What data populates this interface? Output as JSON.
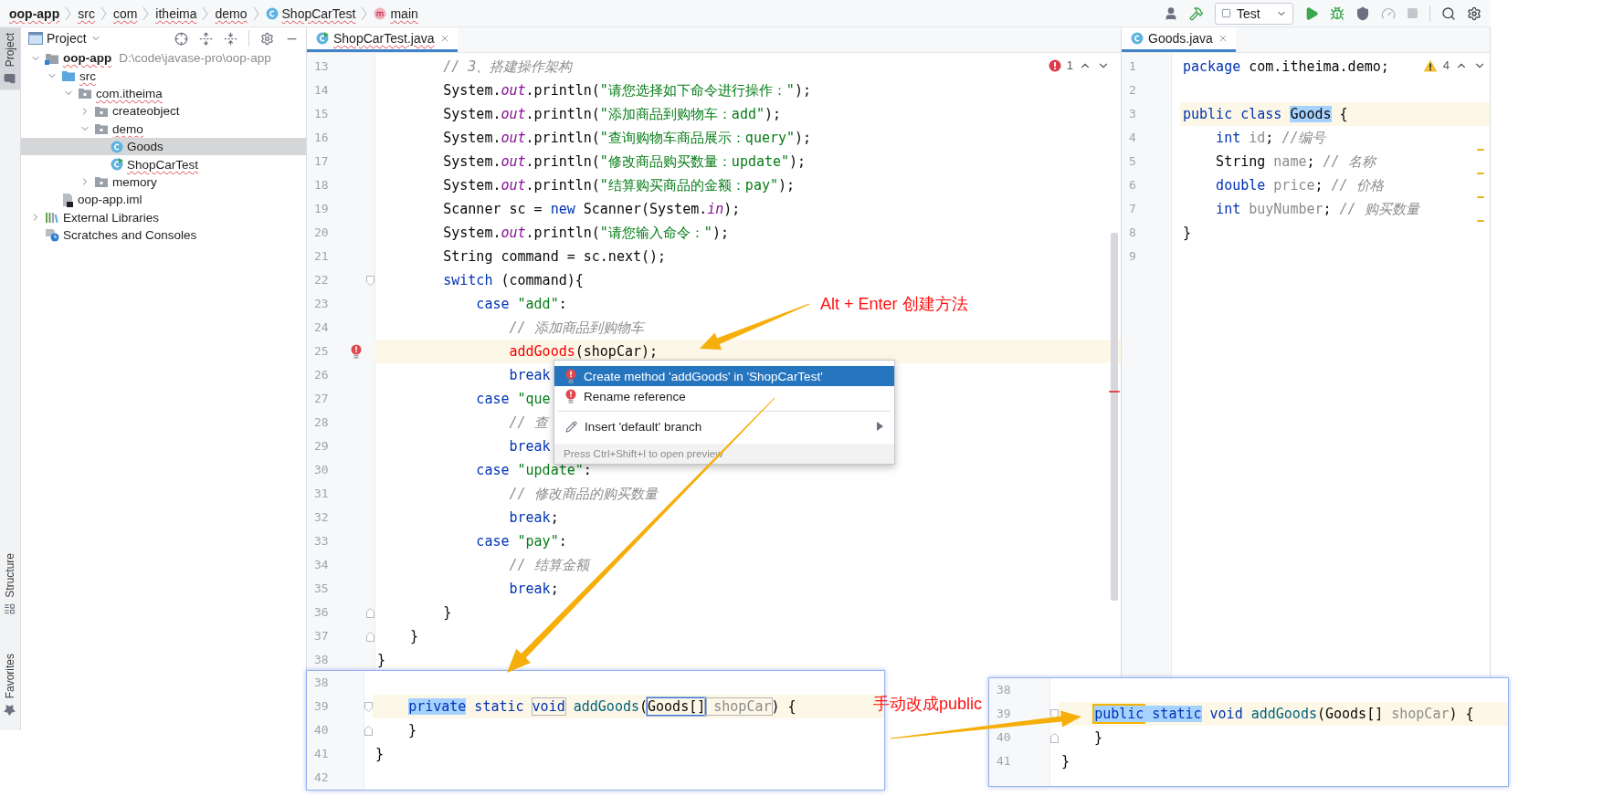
{
  "breadcrumbs": [
    {
      "label": "oop-app",
      "kind": "module",
      "errors": true
    },
    {
      "label": "src",
      "kind": "folder",
      "errors": true
    },
    {
      "label": "com",
      "kind": "folder",
      "errors": true
    },
    {
      "label": "itheima",
      "kind": "folder",
      "errors": true
    },
    {
      "label": "demo",
      "kind": "folder",
      "errors": true
    },
    {
      "label": "ShopCarTest",
      "kind": "class",
      "errors": true
    },
    {
      "label": "main",
      "kind": "method",
      "errors": true
    }
  ],
  "toolbar": {
    "run_config": "Test"
  },
  "side_tabs": {
    "top": [
      {
        "label": "Project",
        "selected": true,
        "kind": "project"
      }
    ],
    "bottom": [
      {
        "label": "Structure",
        "selected": false,
        "kind": "structure"
      },
      {
        "label": "Favorites",
        "selected": false,
        "kind": "favorites"
      }
    ]
  },
  "project_panel": {
    "title": "Project",
    "tree": [
      {
        "label": "oop-app",
        "path": "D:\\code\\javase-pro\\oop-app",
        "kind": "module",
        "expanded": true,
        "selected": false,
        "errors": true,
        "children": [
          {
            "label": "src",
            "kind": "source",
            "expanded": true,
            "selected": false,
            "errors": true,
            "children": [
              {
                "label": "com.itheima",
                "kind": "package",
                "expanded": true,
                "selected": false,
                "errors": true,
                "children": [
                  {
                    "label": "createobject",
                    "kind": "package",
                    "expanded": false,
                    "selected": false,
                    "errors": false
                  },
                  {
                    "label": "demo",
                    "kind": "package",
                    "expanded": true,
                    "selected": false,
                    "errors": true,
                    "children": [
                      {
                        "label": "Goods",
                        "kind": "class",
                        "selected": true,
                        "errors": false
                      },
                      {
                        "label": "ShopCarTest",
                        "kind": "main-class",
                        "selected": false,
                        "errors": true
                      }
                    ]
                  },
                  {
                    "label": "memory",
                    "kind": "package",
                    "expanded": false,
                    "selected": false,
                    "errors": false
                  }
                ]
              }
            ]
          },
          {
            "label": "oop-app.iml",
            "kind": "module-file",
            "selected": false,
            "errors": false
          }
        ]
      },
      {
        "label": "External Libraries",
        "kind": "libraries",
        "expanded": false,
        "selected": false,
        "errors": false
      },
      {
        "label": "Scratches and Consoles",
        "kind": "scratches",
        "selected": false,
        "errors": false
      }
    ]
  },
  "main_editor": {
    "tab": {
      "label": "ShopCarTest.java",
      "selected": true,
      "errors": true
    },
    "problems": {
      "kind": "error",
      "count": "1"
    },
    "lines": [
      {
        "n": "13",
        "current": false,
        "tokens": [
          {
            "kind": "comment",
            "t": "        // 3、搭建操作架构"
          }
        ]
      },
      {
        "n": "14",
        "current": false,
        "tokens": [
          {
            "kind": "plain",
            "t": "        System."
          },
          {
            "kind": "field",
            "t": "out"
          },
          {
            "kind": "plain",
            "t": ".println("
          },
          {
            "kind": "string",
            "t": "\"请您选择如下命令进行操作：\""
          },
          {
            "kind": "plain",
            "t": ");"
          }
        ]
      },
      {
        "n": "15",
        "current": false,
        "tokens": [
          {
            "kind": "plain",
            "t": "        System."
          },
          {
            "kind": "field",
            "t": "out"
          },
          {
            "kind": "plain",
            "t": ".println("
          },
          {
            "kind": "string",
            "t": "\"添加商品到购物车：add\""
          },
          {
            "kind": "plain",
            "t": ");"
          }
        ]
      },
      {
        "n": "16",
        "current": false,
        "tokens": [
          {
            "kind": "plain",
            "t": "        System."
          },
          {
            "kind": "field",
            "t": "out"
          },
          {
            "kind": "plain",
            "t": ".println("
          },
          {
            "kind": "string",
            "t": "\"查询购物车商品展示：query\""
          },
          {
            "kind": "plain",
            "t": ");"
          }
        ]
      },
      {
        "n": "17",
        "current": false,
        "tokens": [
          {
            "kind": "plain",
            "t": "        System."
          },
          {
            "kind": "field",
            "t": "out"
          },
          {
            "kind": "plain",
            "t": ".println("
          },
          {
            "kind": "string",
            "t": "\"修改商品购买数量：update\""
          },
          {
            "kind": "plain",
            "t": ");"
          }
        ]
      },
      {
        "n": "18",
        "current": false,
        "tokens": [
          {
            "kind": "plain",
            "t": "        System."
          },
          {
            "kind": "field",
            "t": "out"
          },
          {
            "kind": "plain",
            "t": ".println("
          },
          {
            "kind": "string",
            "t": "\"结算购买商品的金额：pay\""
          },
          {
            "kind": "plain",
            "t": ");"
          }
        ]
      },
      {
        "n": "19",
        "current": false,
        "tokens": [
          {
            "kind": "plain",
            "t": "        Scanner sc = "
          },
          {
            "kind": "keyword",
            "t": "new"
          },
          {
            "kind": "plain",
            "t": " Scanner(System."
          },
          {
            "kind": "field",
            "t": "in"
          },
          {
            "kind": "plain",
            "t": ");"
          }
        ]
      },
      {
        "n": "20",
        "current": false,
        "tokens": [
          {
            "kind": "plain",
            "t": "        System."
          },
          {
            "kind": "field",
            "t": "out"
          },
          {
            "kind": "plain",
            "t": ".println("
          },
          {
            "kind": "string",
            "t": "\"请您输入命令：\""
          },
          {
            "kind": "plain",
            "t": ");"
          }
        ]
      },
      {
        "n": "21",
        "current": false,
        "tokens": [
          {
            "kind": "plain",
            "t": "        String command = sc.next();"
          }
        ]
      },
      {
        "n": "22",
        "current": false,
        "markers": [
          {
            "kind": "fold-start"
          }
        ],
        "tokens": [
          {
            "kind": "keyword",
            "t": "        switch"
          },
          {
            "kind": "plain",
            "t": " (command){"
          }
        ]
      },
      {
        "n": "23",
        "current": false,
        "tokens": [
          {
            "kind": "keyword",
            "t": "            case "
          },
          {
            "kind": "string",
            "t": "\"add\""
          },
          {
            "kind": "plain",
            "t": ":"
          }
        ]
      },
      {
        "n": "24",
        "current": false,
        "tokens": [
          {
            "kind": "comment",
            "t": "                // 添加商品到购物车"
          }
        ]
      },
      {
        "n": "25",
        "current": true,
        "markers": [
          {
            "kind": "error"
          }
        ],
        "tokens": [
          {
            "kind": "error",
            "t": "                addGoods"
          },
          {
            "kind": "plain",
            "t": "(shopCar);"
          }
        ]
      },
      {
        "n": "26",
        "current": false,
        "tokens": [
          {
            "kind": "keyword",
            "t": "                break"
          }
        ]
      },
      {
        "n": "27",
        "current": false,
        "tokens": [
          {
            "kind": "keyword",
            "t": "            case "
          },
          {
            "kind": "string",
            "t": "\"que"
          }
        ]
      },
      {
        "n": "28",
        "current": false,
        "tokens": [
          {
            "kind": "comment",
            "t": "                // 查"
          }
        ]
      },
      {
        "n": "29",
        "current": false,
        "tokens": [
          {
            "kind": "keyword",
            "t": "                break"
          }
        ]
      },
      {
        "n": "30",
        "current": false,
        "tokens": [
          {
            "kind": "keyword",
            "t": "            case "
          },
          {
            "kind": "string",
            "t": "\"update\""
          },
          {
            "kind": "plain",
            "t": ":"
          }
        ]
      },
      {
        "n": "31",
        "current": false,
        "tokens": [
          {
            "kind": "comment",
            "t": "                // 修改商品的购买数量"
          }
        ]
      },
      {
        "n": "32",
        "current": false,
        "tokens": [
          {
            "kind": "keyword",
            "t": "                break"
          },
          {
            "kind": "plain",
            "t": ";"
          }
        ]
      },
      {
        "n": "33",
        "current": false,
        "tokens": [
          {
            "kind": "keyword",
            "t": "            case "
          },
          {
            "kind": "string",
            "t": "\"pay\""
          },
          {
            "kind": "plain",
            "t": ":"
          }
        ]
      },
      {
        "n": "34",
        "current": false,
        "tokens": [
          {
            "kind": "comment",
            "t": "                // 结算金额"
          }
        ]
      },
      {
        "n": "35",
        "current": false,
        "tokens": [
          {
            "kind": "keyword",
            "t": "                break"
          },
          {
            "kind": "plain",
            "t": ";"
          }
        ]
      },
      {
        "n": "36",
        "current": false,
        "markers": [
          {
            "kind": "fold-end"
          }
        ],
        "tokens": [
          {
            "kind": "plain",
            "t": "        }"
          }
        ]
      },
      {
        "n": "37",
        "current": false,
        "markers": [
          {
            "kind": "fold-end"
          }
        ],
        "tokens": [
          {
            "kind": "plain",
            "t": "    }"
          }
        ]
      },
      {
        "n": "38",
        "current": false,
        "tokens": [
          {
            "kind": "plain",
            "t": "}"
          }
        ]
      }
    ]
  },
  "popup": {
    "items": [
      {
        "label": "Create method 'addGoods' in 'ShopCarTest'",
        "selected": true,
        "kind": "quick-fix",
        "submenu": false
      },
      {
        "label": "Rename reference",
        "selected": false,
        "kind": "quick-fix",
        "submenu": false
      },
      {
        "label": "Insert 'default' branch",
        "selected": false,
        "kind": "intention",
        "submenu": true
      }
    ],
    "hint": "Press Ctrl+Shift+I to open preview"
  },
  "side_editor": {
    "tab": {
      "label": "Goods.java",
      "selected": true,
      "errors": false
    },
    "problems": {
      "kind": "warning",
      "count": "4"
    },
    "lines": [
      {
        "n": "1",
        "current": false,
        "tokens": [
          {
            "kind": "keyword",
            "t": "package"
          },
          {
            "kind": "plain",
            "t": " com.itheima.demo;"
          }
        ]
      },
      {
        "n": "2"
      },
      {
        "n": "3",
        "current": true,
        "tokens": [
          {
            "kind": "keyword",
            "t": "public class "
          },
          {
            "kind": "plain",
            "t": "Goods",
            "selected": true
          },
          {
            "kind": "plain",
            "t": " {"
          }
        ]
      },
      {
        "n": "4",
        "current": false,
        "tokens": [
          {
            "kind": "keyword",
            "t": "    int "
          },
          {
            "kind": "unused",
            "t": "id"
          },
          {
            "kind": "plain",
            "t": "; "
          },
          {
            "kind": "comment",
            "t": "//编号"
          }
        ]
      },
      {
        "n": "5",
        "current": false,
        "tokens": [
          {
            "kind": "plain",
            "t": "    String "
          },
          {
            "kind": "unused",
            "t": "name"
          },
          {
            "kind": "plain",
            "t": "; "
          },
          {
            "kind": "comment",
            "t": "// 名称"
          }
        ]
      },
      {
        "n": "6",
        "current": false,
        "tokens": [
          {
            "kind": "keyword",
            "t": "    double "
          },
          {
            "kind": "unused",
            "t": "price"
          },
          {
            "kind": "plain",
            "t": "; "
          },
          {
            "kind": "comment",
            "t": "// 价格"
          }
        ]
      },
      {
        "n": "7",
        "current": false,
        "tokens": [
          {
            "kind": "keyword",
            "t": "    int "
          },
          {
            "kind": "unused",
            "t": "buyNumber"
          },
          {
            "kind": "plain",
            "t": "; "
          },
          {
            "kind": "comment",
            "t": "// 购买数量"
          }
        ]
      },
      {
        "n": "8",
        "current": false,
        "tokens": [
          {
            "kind": "plain",
            "t": "}"
          }
        ]
      },
      {
        "n": "9"
      }
    ]
  },
  "insets": [
    {
      "lines": [
        {
          "n": "38"
        },
        {
          "n": "39",
          "current": true,
          "markers": [
            {
              "kind": "fold-start"
            }
          ],
          "tokens": [
            {
              "kind": "keyword",
              "t": "    private",
              "selected": true
            },
            {
              "kind": "keyword",
              "t": " static "
            },
            {
              "kind": "keyword",
              "t": "void",
              "boxed": true
            },
            {
              "kind": "declaration",
              "t": " addGoods"
            },
            {
              "kind": "plain",
              "t": "("
            },
            {
              "kind": "plain",
              "t": "Goods[]",
              "focused": true
            },
            {
              "kind": "unused",
              "t": " shopCar",
              "boxed": true
            },
            {
              "kind": "plain",
              "t": ") {"
            }
          ]
        },
        {
          "n": "40",
          "current": false,
          "markers": [
            {
              "kind": "fold-end"
            }
          ],
          "tokens": [
            {
              "kind": "plain",
              "t": "    }"
            }
          ]
        },
        {
          "n": "41",
          "current": false,
          "tokens": [
            {
              "kind": "plain",
              "t": "}"
            }
          ]
        },
        {
          "n": "42"
        }
      ]
    },
    {
      "lines": [
        {
          "n": "38"
        },
        {
          "n": "39",
          "current": true,
          "markers": [
            {
              "kind": "fold-start"
            }
          ],
          "tokens": [
            {
              "kind": "keyword",
              "t": "    public",
              "selected": true,
              "marked": true
            },
            {
              "kind": "keyword",
              "t": " static",
              "selected": true
            },
            {
              "kind": "keyword",
              "t": " void"
            },
            {
              "kind": "declaration",
              "t": " addGoods"
            },
            {
              "kind": "plain",
              "t": "(Goods[] "
            },
            {
              "kind": "unused",
              "t": "shopCar"
            },
            {
              "kind": "plain",
              "t": ") {"
            }
          ]
        },
        {
          "n": "40",
          "current": false,
          "markers": [
            {
              "kind": "fold-end"
            }
          ],
          "tokens": [
            {
              "kind": "plain",
              "t": "    }"
            }
          ]
        },
        {
          "n": "41",
          "current": false,
          "tokens": [
            {
              "kind": "plain",
              "t": "}"
            }
          ]
        }
      ]
    }
  ],
  "annotations": [
    {
      "text": "Alt + Enter 创建方法"
    },
    {
      "text": "手动改成public"
    }
  ]
}
